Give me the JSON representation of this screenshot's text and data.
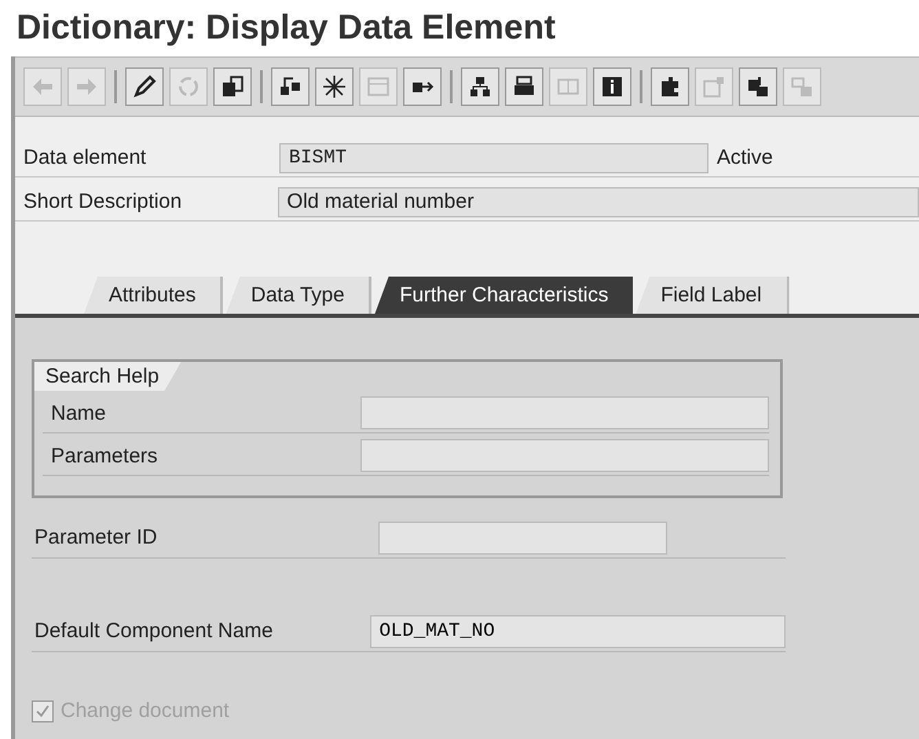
{
  "window": {
    "title": "Dictionary: Display Data Element"
  },
  "toolbar_groups": [
    [
      {
        "disabled": true
      },
      {
        "disabled": true
      }
    ],
    [
      {
        "disabled": false
      },
      {
        "disabled": true
      },
      {
        "disabled": false
      }
    ],
    [
      {
        "disabled": false
      },
      {
        "disabled": false
      },
      {
        "disabled": true
      },
      {
        "disabled": false
      }
    ],
    [
      {
        "disabled": false
      },
      {
        "disabled": false
      },
      {
        "disabled": true
      },
      {
        "disabled": false
      }
    ],
    [
      {
        "disabled": false
      },
      {
        "disabled": true
      },
      {
        "disabled": false
      },
      {
        "disabled": true
      }
    ]
  ],
  "header_fields": [
    {
      "label": "Data element",
      "value": "BISMT",
      "status": "Active"
    },
    {
      "label": "Short Description",
      "value": "Old material number"
    }
  ],
  "tabs": [
    {
      "label": "Attributes",
      "selected": false
    },
    {
      "label": "Data Type",
      "selected": false
    },
    {
      "label": "Further Characteristics",
      "selected": true
    },
    {
      "label": "Field Label",
      "selected": false
    }
  ],
  "search_help": {
    "title": "Search Help",
    "fields": [
      {
        "label": "Name"
      },
      {
        "label": "Parameters"
      }
    ]
  },
  "parameter_id": {
    "label": "Parameter ID"
  },
  "default_component_name": {
    "label": "Default Component Name",
    "value": "OLD_MAT_NO"
  },
  "change_document": {
    "label": "Change document",
    "checked": true,
    "disabled": true
  }
}
